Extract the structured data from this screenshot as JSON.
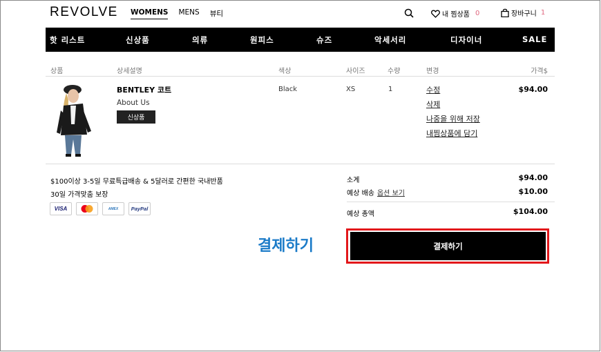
{
  "header": {
    "logo": "REVOLVE",
    "nav": [
      {
        "label": "WOMENS",
        "active": true
      },
      {
        "label": "MENS",
        "active": false
      },
      {
        "label": "뷰티",
        "active": false
      }
    ],
    "wishlist_label": "내 찜상품",
    "wishlist_count": "0",
    "cart_label": "장바구니",
    "cart_count": "1",
    "icons": [
      "search-icon",
      "heart-icon",
      "bag-icon"
    ]
  },
  "categories": [
    "핫 리스트",
    "신상품",
    "의류",
    "원피스",
    "슈즈",
    "악세서리",
    "디자이너",
    "SALE"
  ],
  "table_headers": {
    "product": "상품",
    "description": "상세설명",
    "color": "색상",
    "size": "사이즈",
    "qty": "수량",
    "change": "변경",
    "price": "가격$"
  },
  "item": {
    "name": "BENTLEY 코트",
    "brand": "About Us",
    "badge": "신상품",
    "color": "Black",
    "size": "XS",
    "qty": "1",
    "actions": [
      "수정",
      "삭제",
      "나중을 위해 저장",
      "내찜상품에 담기"
    ],
    "price": "$94.00"
  },
  "shipping": {
    "line1": "$100이상 3-5일 무료특급배송 & 5달러로 간편한 국내반품",
    "line2": "30일 가격맞춤 보장"
  },
  "payment_cards": [
    "VISA",
    "MC",
    "AMEX",
    "PayPal"
  ],
  "summary": {
    "subtotal_label": "소계",
    "subtotal_value": "$94.00",
    "shipping_label": "예상 배송",
    "shipping_option": "옵션 보기",
    "shipping_value": "$10.00",
    "total_label": "예상 총액",
    "total_value": "$104.00"
  },
  "annotation": "결제하기",
  "checkout_label": "결제하기",
  "colors": {
    "accent_pink": "#e0677f",
    "highlight_red": "#e2171a",
    "annotation_blue": "#1b7bc8"
  }
}
